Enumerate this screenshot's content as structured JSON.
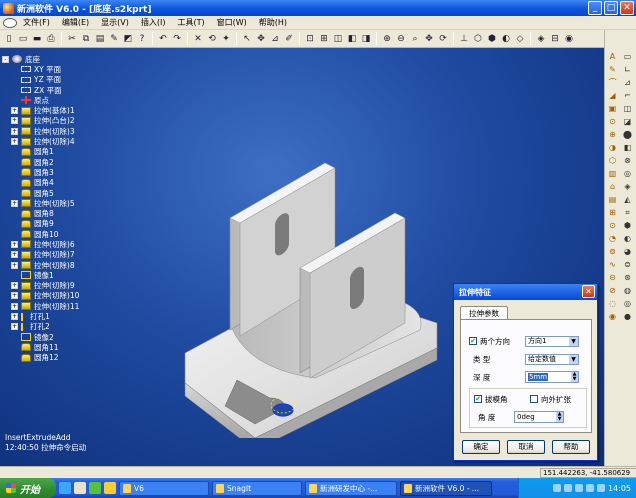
{
  "window": {
    "title": "新洲软件 V6.0 - [底座.s2kprt]",
    "min": "_",
    "max": "□",
    "close": "✕"
  },
  "menu": [
    "文件(F)",
    "编辑(E)",
    "显示(V)",
    "插入(I)",
    "工具(T)",
    "窗口(W)",
    "帮助(H)"
  ],
  "toolbar_icons": [
    "new-icon",
    "open-icon",
    "save-icon",
    "print-icon",
    "cut-icon",
    "copy-icon",
    "paste-icon",
    "brush-icon",
    "format-icon",
    "help-icon",
    "undo-icon",
    "redo-icon",
    "delete-icon",
    "rebuild-icon",
    "feature-icon",
    "select-icon",
    "pick-icon",
    "measure-icon",
    "sketch-icon",
    "view-fit-icon",
    "view-box-icon",
    "view-front-icon",
    "view-top-icon",
    "view-side-icon",
    "zoom-in-icon",
    "zoom-out-icon",
    "zoom-box-icon",
    "pan-icon",
    "rotate-icon",
    "axis-icon",
    "cube-icon",
    "iso-icon",
    "shade-icon",
    "wire-icon",
    "hidden-icon",
    "section-icon",
    "render-icon"
  ],
  "toolbar_glyphs": [
    "▯",
    "▭",
    "▬",
    "⎙",
    "✂",
    "⧉",
    "▤",
    "✎",
    "◩",
    "?",
    "↶",
    "↷",
    "✕",
    "⟲",
    "✦",
    "↖",
    "✥",
    "⊿",
    "✐",
    "⊡",
    "⊞",
    "◫",
    "◧",
    "◨",
    "⊕",
    "⊖",
    "⌕",
    "✥",
    "⟳",
    "⊥",
    "⬡",
    "⬢",
    "◐",
    "◇",
    "◈",
    "⊟",
    "◉"
  ],
  "right_glyphs": [
    "A",
    "▭",
    "✎",
    "∟",
    "⌒",
    "⊿",
    "◢",
    "⌐",
    "▣",
    "◫",
    "⊙",
    "◪",
    "⊕",
    "⬤",
    "◑",
    "◧",
    "⬡",
    "⊗",
    "▥",
    "◎",
    "⌂",
    "◈",
    "▤",
    "◭",
    "⊞",
    "⌗",
    "⊙",
    "⬢",
    "◔",
    "◐",
    "⊚",
    "◕",
    "∿",
    "⊜",
    "⊝",
    "⊛",
    "⊘",
    "◍",
    "◌",
    "◎",
    "◉",
    "●"
  ],
  "tree": [
    {
      "label": "底座",
      "icon": "base",
      "level": 0,
      "exp": "-"
    },
    {
      "label": "XY 平面",
      "icon": "plane",
      "level": 1,
      "exp": ""
    },
    {
      "label": "YZ 平面",
      "icon": "plane",
      "level": 1,
      "exp": ""
    },
    {
      "label": "ZX 平面",
      "icon": "plane",
      "level": 1,
      "exp": ""
    },
    {
      "label": "原点",
      "icon": "origin",
      "level": 1,
      "exp": ""
    },
    {
      "label": "拉伸(基体)1",
      "icon": "feat",
      "level": 1,
      "exp": "+"
    },
    {
      "label": "拉伸(凸台)2",
      "icon": "feat",
      "level": 1,
      "exp": "+"
    },
    {
      "label": "拉伸(切除)3",
      "icon": "feat",
      "level": 1,
      "exp": "+"
    },
    {
      "label": "拉伸(切除)4",
      "icon": "feat",
      "level": 1,
      "exp": "+"
    },
    {
      "label": "圆角1",
      "icon": "round",
      "level": 1,
      "exp": ""
    },
    {
      "label": "圆角2",
      "icon": "round",
      "level": 1,
      "exp": ""
    },
    {
      "label": "圆角3",
      "icon": "round",
      "level": 1,
      "exp": ""
    },
    {
      "label": "圆角4",
      "icon": "round",
      "level": 1,
      "exp": ""
    },
    {
      "label": "圆角5",
      "icon": "round",
      "level": 1,
      "exp": ""
    },
    {
      "label": "拉伸(切除)5",
      "icon": "feat",
      "level": 1,
      "exp": "+"
    },
    {
      "label": "圆角8",
      "icon": "round",
      "level": 1,
      "exp": ""
    },
    {
      "label": "圆角9",
      "icon": "round",
      "level": 1,
      "exp": ""
    },
    {
      "label": "圆角10",
      "icon": "round",
      "level": 1,
      "exp": ""
    },
    {
      "label": "拉伸(切除)6",
      "icon": "feat",
      "level": 1,
      "exp": "+"
    },
    {
      "label": "拉伸(切除)7",
      "icon": "feat",
      "level": 1,
      "exp": "+"
    },
    {
      "label": "拉伸(切除)8",
      "icon": "feat",
      "level": 1,
      "exp": "+"
    },
    {
      "label": "镜像1",
      "icon": "mirror",
      "level": 1,
      "exp": ""
    },
    {
      "label": "拉伸(切除)9",
      "icon": "feat",
      "level": 1,
      "exp": "+"
    },
    {
      "label": "拉伸(切除)10",
      "icon": "feat",
      "level": 1,
      "exp": "+"
    },
    {
      "label": "拉伸(切除)11",
      "icon": "feat",
      "level": 1,
      "exp": "+"
    },
    {
      "label": "打孔1",
      "icon": "hole",
      "level": 1,
      "exp": "+"
    },
    {
      "label": "打孔2",
      "icon": "hole",
      "level": 1,
      "exp": "+"
    },
    {
      "label": "镜像2",
      "icon": "mirror",
      "level": 1,
      "exp": ""
    },
    {
      "label": "圆角11",
      "icon": "round",
      "level": 1,
      "exp": ""
    },
    {
      "label": "圆角12",
      "icon": "round",
      "level": 1,
      "exp": ""
    }
  ],
  "command_log": [
    "InsertExtrudeAdd",
    "12:40:50 拉伸命令启动"
  ],
  "dialog": {
    "title": "拉伸特征",
    "close": "✕",
    "tab": "拉伸参数",
    "two_dir_label": "两个方向",
    "two_dir_checked": true,
    "direction_value": "方向1",
    "type_label": "类 型",
    "type_value": "给定数值",
    "depth_label": "深 度",
    "depth_value": "5mm",
    "draft_label": "拔模角",
    "draft_checked": true,
    "outward_label": "向外扩张",
    "outward_checked": false,
    "angle_label": "角 度",
    "angle_value": "0deg",
    "ok": "确定",
    "cancel": "取消",
    "help": "帮助"
  },
  "status": {
    "coords": "151.442263, -41.580629"
  },
  "taskbar": {
    "start": "开始",
    "tasks": [
      {
        "label": "V6",
        "active": false
      },
      {
        "label": "SnagIt",
        "active": false
      },
      {
        "label": "新洲研发中心 -...",
        "active": false
      },
      {
        "label": "新洲软件 V6.0 - ...",
        "active": true
      }
    ],
    "time": "14:05"
  },
  "colors": {
    "accent": "#0a55dd",
    "viewport": "#1e4aa0",
    "chrome": "#ece9d8"
  }
}
